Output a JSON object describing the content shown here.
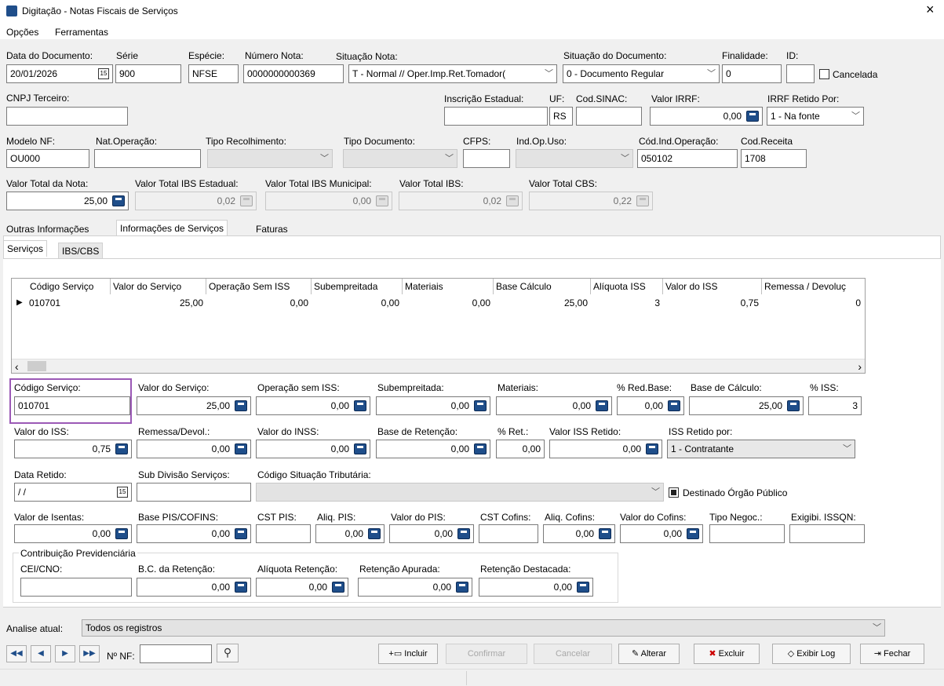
{
  "window": {
    "title": "Digitação - Notas Fiscais de Serviços",
    "close": "×"
  },
  "menu": [
    "Opções",
    "Ferramentas"
  ],
  "header": {
    "data_documento": {
      "label": "Data do Documento:",
      "value": "20/01/2026"
    },
    "serie": {
      "label": "Série",
      "value": "900"
    },
    "especie": {
      "label": "Espécie:",
      "value": "NFSE"
    },
    "numero_nota": {
      "label": "Número Nota:",
      "value": "0000000000369"
    },
    "situacao_nota": {
      "label": "Situação Nota:",
      "value": "T - Normal // Oper.Imp.Ret.Tomador("
    },
    "situacao_documento": {
      "label": "Situação do Documento:",
      "value": "0 - Documento Regular"
    },
    "finalidade": {
      "label": "Finalidade:",
      "value": "0"
    },
    "id": {
      "label": "ID:",
      "value": ""
    },
    "cancelada": {
      "label": "Cancelada"
    },
    "cnpj_terceiro": {
      "label": "CNPJ Terceiro:",
      "value": ""
    },
    "inscricao_estadual": {
      "label": "Inscrição Estadual:",
      "value": ""
    },
    "uf": {
      "label": "UF:",
      "value": "RS"
    },
    "cod_sinac": {
      "label": "Cod.SINAC:",
      "value": ""
    },
    "valor_irrf": {
      "label": "Valor IRRF:",
      "value": "0,00"
    },
    "irrf_retido_por": {
      "label": "IRRF Retido Por:",
      "value": "1 - Na fonte"
    },
    "modelo_nf": {
      "label": "Modelo NF:",
      "value": "OU000"
    },
    "nat_operacao": {
      "label": "Nat.Operação:",
      "value": ""
    },
    "tipo_recolhimento": {
      "label": "Tipo Recolhimento:",
      "value": ""
    },
    "tipo_documento": {
      "label": "Tipo Documento:",
      "value": ""
    },
    "cfps": {
      "label": "CFPS:",
      "value": ""
    },
    "ind_op_uso": {
      "label": "Ind.Op.Uso:",
      "value": ""
    },
    "cod_ind_operacao": {
      "label": "Cód.Ind.Operação:",
      "value": "050102"
    },
    "cod_receita": {
      "label": "Cod.Receita",
      "value": "1708"
    },
    "valor_total_nota": {
      "label": "Valor Total da Nota:",
      "value": "25,00"
    },
    "valor_total_ibs_estadual": {
      "label": "Valor Total IBS Estadual:",
      "value": "0,02"
    },
    "valor_total_ibs_municipal": {
      "label": "Valor Total IBS Municipal:",
      "value": "0,00"
    },
    "valor_total_ibs": {
      "label": "Valor Total IBS:",
      "value": "0,02"
    },
    "valor_total_cbs": {
      "label": "Valor Total CBS:",
      "value": "0,22"
    }
  },
  "tabs": [
    "Outras Informações",
    "Informações de Serviços",
    "Faturas"
  ],
  "subtabs": [
    "Serviços",
    "IBS/CBS"
  ],
  "grid": {
    "columns": [
      "Código Serviço",
      "Valor do Serviço",
      "Operação Sem ISS",
      "Subempreitada",
      "Materiais",
      "Base Cálculo",
      "Alíquota ISS",
      "Valor do ISS",
      "Remessa / Devoluç"
    ],
    "row": [
      "010701",
      "25,00",
      "0,00",
      "0,00",
      "0,00",
      "25,00",
      "3",
      "0,75",
      "0"
    ],
    "row_marker": "▶",
    "scroll_left": "‹",
    "scroll_right": "›"
  },
  "detail": {
    "codigo_servico": {
      "label": "Código Serviço:",
      "value": "010701"
    },
    "valor_servico": {
      "label": "Valor do Serviço:",
      "value": "25,00"
    },
    "operacao_sem_iss": {
      "label": "Operação sem ISS:",
      "value": "0,00"
    },
    "subempreitada": {
      "label": "Subempreitada:",
      "value": "0,00"
    },
    "materiais": {
      "label": "Materiais:",
      "value": "0,00"
    },
    "red_base": {
      "label": "% Red.Base:",
      "value": "0,00"
    },
    "base_calculo": {
      "label": "Base de Cálculo:",
      "value": "25,00"
    },
    "pct_iss": {
      "label": "% ISS:",
      "value": "3"
    },
    "valor_iss": {
      "label": "Valor do ISS:",
      "value": "0,75"
    },
    "remessa_devol": {
      "label": "Remessa/Devol.:",
      "value": "0,00"
    },
    "valor_inss": {
      "label": "Valor do INSS:",
      "value": "0,00"
    },
    "base_retencao": {
      "label": "Base de Retenção:",
      "value": "0,00"
    },
    "pct_ret": {
      "label": "% Ret.:",
      "value": "0,00"
    },
    "valor_iss_retido": {
      "label": "Valor ISS Retido:",
      "value": "0,00"
    },
    "iss_retido_por": {
      "label": "ISS Retido por:",
      "value": "1 - Contratante"
    },
    "data_retido": {
      "label": "Data Retido:",
      "value": "/ /"
    },
    "sub_divisao": {
      "label": "Sub Divisão Serviços:",
      "value": ""
    },
    "cod_sit_trib": {
      "label": "Código Situação Tributária:",
      "value": ""
    },
    "destinado_orgao": {
      "label": "Destinado Órgão Público"
    },
    "valor_isentas": {
      "label": "Valor de Isentas:",
      "value": "0,00"
    },
    "base_pis_cofins": {
      "label": "Base PIS/COFINS:",
      "value": "0,00"
    },
    "cst_pis": {
      "label": "CST PIS:",
      "value": ""
    },
    "aliq_pis": {
      "label": "Aliq. PIS:",
      "value": "0,00"
    },
    "valor_pis": {
      "label": "Valor do PIS:",
      "value": "0,00"
    },
    "cst_cofins": {
      "label": "CST Cofins:",
      "value": ""
    },
    "aliq_cofins": {
      "label": "Aliq. Cofins:",
      "value": "0,00"
    },
    "valor_cofins": {
      "label": "Valor do Cofins:",
      "value": "0,00"
    },
    "tipo_negoc": {
      "label": "Tipo Negoc.:",
      "value": ""
    },
    "exigibi_issqn": {
      "label": "Exigibi. ISSQN:",
      "value": ""
    }
  },
  "contribuicao": {
    "title": "Contribuição Previdenciária",
    "cei_cno": {
      "label": "CEI/CNO:",
      "value": ""
    },
    "bc_retencao": {
      "label": "B.C. da Retenção:",
      "value": "0,00"
    },
    "aliquota_retencao": {
      "label": "Alíquota Retenção:",
      "value": "0,00"
    },
    "retencao_apurada": {
      "label": "Retenção Apurada:",
      "value": "0,00"
    },
    "retencao_destacada": {
      "label": "Retenção Destacada:",
      "value": "0,00"
    }
  },
  "analise": {
    "label": "Analise atual:",
    "value": "Todos os registros"
  },
  "footer": {
    "nf_label": "Nº NF:",
    "nf_value": "",
    "buttons": {
      "incluir": "Incluir",
      "confirmar": "Confirmar",
      "cancelar": "Cancelar",
      "alterar": "Alterar",
      "excluir": "Excluir",
      "exibir_log": "Exibir Log",
      "fechar": "Fechar"
    }
  },
  "colors": {
    "accent": "#1f4e8a",
    "highlight_border": "#9b59b6"
  }
}
